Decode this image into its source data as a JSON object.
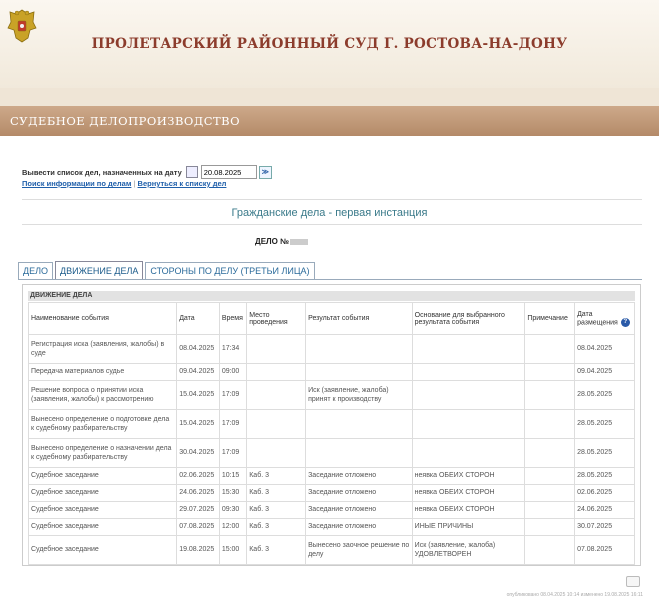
{
  "header": {
    "court_title": "ПРОЛЕТАРСКИЙ РАЙОННЫЙ СУД Г. РОСТОВА-НА-ДОНУ",
    "section_title": "СУДЕБНОЕ ДЕЛОПРОИЗВОДСТВО"
  },
  "date_filter": {
    "label": "Вывести список дел, назначенных на дату",
    "value": "20.08.2025",
    "go_glyph": "≫"
  },
  "links": {
    "search": "Поиск информации по делам",
    "back": "Вернуться к списку дел",
    "separator": "|"
  },
  "instance_title": "Гражданские дела - первая инстанция",
  "case_number_label": "ДЕЛО №",
  "tabs": [
    {
      "label": "ДЕЛО"
    },
    {
      "label": "ДВИЖЕНИЕ ДЕЛА"
    },
    {
      "label": "СТОРОНЫ ПО ДЕЛУ (ТРЕТЬИ ЛИЦА)"
    }
  ],
  "active_tab": "ДВИЖЕНИЕ ДЕЛА",
  "events_table": {
    "title": "ДВИЖЕНИЕ ДЕЛА",
    "columns": [
      "Наименование события",
      "Дата",
      "Время",
      "Место проведения",
      "Результат события",
      "Основание для выбранного результата события",
      "Примечание",
      "Дата размещения"
    ],
    "rows": [
      [
        "Регистрация иска (заявления, жалобы) в суде",
        "08.04.2025",
        "17:34",
        "",
        "",
        "",
        "",
        "08.04.2025"
      ],
      [
        "Передача материалов судье",
        "09.04.2025",
        "09:00",
        "",
        "",
        "",
        "",
        "09.04.2025"
      ],
      [
        "Решение вопроса о принятии иска (заявления, жалобы) к рассмотрению",
        "15.04.2025",
        "17:09",
        "",
        "Иск (заявление, жалоба) принят к производству",
        "",
        "",
        "28.05.2025"
      ],
      [
        "Вынесено определение о подготовке дела к судебному разбирательству",
        "15.04.2025",
        "17:09",
        "",
        "",
        "",
        "",
        "28.05.2025"
      ],
      [
        "Вынесено определение о назначении дела к судебному разбирательству",
        "30.04.2025",
        "17:09",
        "",
        "",
        "",
        "",
        "28.05.2025"
      ],
      [
        "Судебное заседание",
        "02.06.2025",
        "10:15",
        "Каб. 3",
        "Заседание отложено",
        "неявка ОБЕИХ СТОРОН",
        "",
        "28.05.2025"
      ],
      [
        "Судебное заседание",
        "24.06.2025",
        "15:30",
        "Каб. 3",
        "Заседание отложено",
        "неявка ОБЕИХ СТОРОН",
        "",
        "02.06.2025"
      ],
      [
        "Судебное заседание",
        "29.07.2025",
        "09:30",
        "Каб. 3",
        "Заседание отложено",
        "неявка ОБЕИХ СТОРОН",
        "",
        "24.06.2025"
      ],
      [
        "Судебное заседание",
        "07.08.2025",
        "12:00",
        "Каб. 3",
        "Заседание отложено",
        "ИНЫЕ ПРИЧИНЫ",
        "",
        "30.07.2025"
      ],
      [
        "Судебное заседание",
        "19.08.2025",
        "15:00",
        "Каб. 3",
        "Вынесено заочное решение по делу",
        "Иск (заявление, жалоба) УДОВЛЕТВОРЕН",
        "",
        "07.08.2025"
      ]
    ],
    "row_heights": [
      "tall",
      "short",
      "tall",
      "tall",
      "tall",
      "short",
      "short",
      "short",
      "short",
      "tall"
    ]
  },
  "footer_text": "опубликовано 08.04.2025 10:14 изменено 19.08.2025 16:11"
}
